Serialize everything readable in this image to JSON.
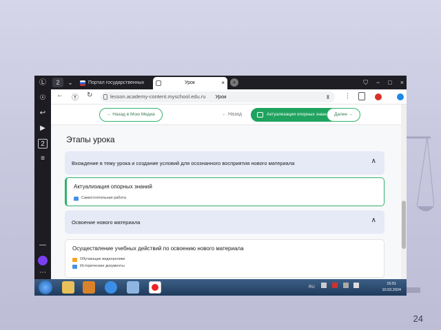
{
  "slide_number": "24",
  "tabs": [
    {
      "title": "Портал государственных",
      "close": "×"
    },
    {
      "title": "Урок",
      "close": "×"
    }
  ],
  "tab_controls": {
    "profile": "1",
    "tab_count": "2",
    "tab_menu": "⌄",
    "new_tab": "+"
  },
  "window_buttons": {
    "shield": "⛉",
    "minimize": "−",
    "maximize": "□",
    "close": "×"
  },
  "address_bar": {
    "back": "←",
    "reload": "↻",
    "yandex": "Ⓨ",
    "url": "lesson.academy-content.myschool.edu.ru",
    "page_title": "Урок",
    "bookmark": "▮",
    "more": "⋮"
  },
  "left_strip": {
    "icons": [
      "Ⓛ",
      "☉",
      "↩",
      "▶",
      "2",
      "≡",
      "⋯"
    ]
  },
  "nav": {
    "back_to_my_library": "← Назад в Мою Медиа",
    "prev": "← Назад",
    "current_lesson": "Актуализация опорных знаний",
    "next": "Далее →"
  },
  "heading": "Этапы урока",
  "sections": [
    {
      "title": "Вхождение в тему урока и создание условий для осознанного восприятия нового материала",
      "chevron": "∧"
    },
    {
      "title": "Актуализация опорных знаний",
      "items": [
        "Самостоятельная работа"
      ]
    },
    {
      "title": "Освоение нового материала",
      "chevron": "∧"
    },
    {
      "title": "Осуществление учебных действий по освоению нового материала",
      "items": [
        "Обучающие видеоролики",
        "Исторические документы"
      ]
    }
  ],
  "taskbar": {
    "tray_lang": "RU",
    "time": "15:51",
    "date": "10.03.2024"
  },
  "colors": {
    "accent_green": "#1fa35e",
    "section_bg": "#e6eaf6",
    "taskbar": "#2b4a70"
  }
}
